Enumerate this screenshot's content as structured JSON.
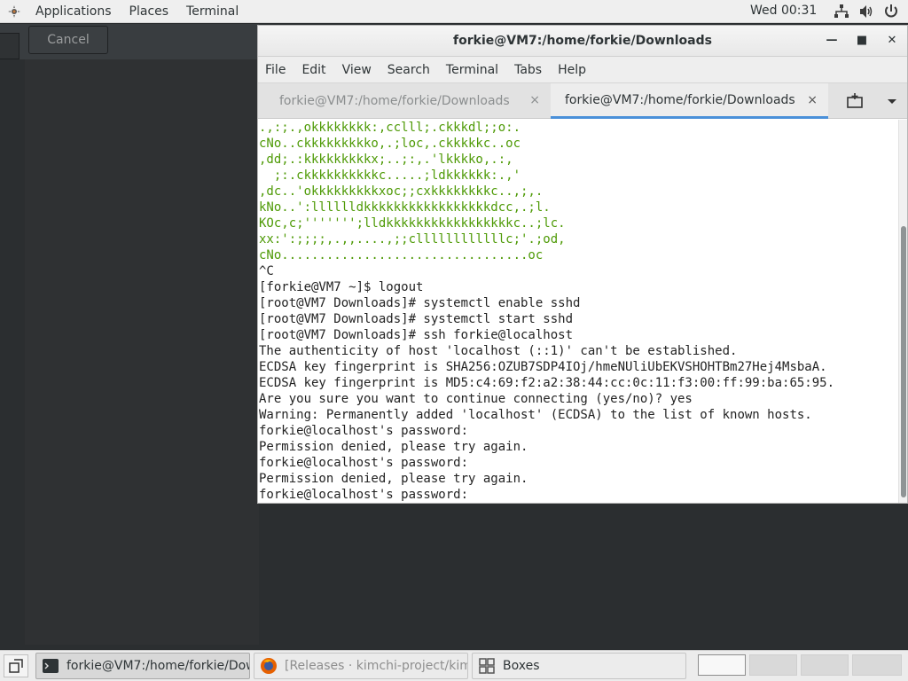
{
  "topbar": {
    "applications": "Applications",
    "places": "Places",
    "terminal": "Terminal",
    "clock": "Wed 00:31",
    "icons": [
      "network-icon",
      "volume-icon",
      "power-icon"
    ]
  },
  "background_dialog": {
    "cancel_label": "Cancel"
  },
  "window": {
    "title": "forkie@VM7:/home/forkie/Downloads",
    "controls": [
      "minimize-icon",
      "maximize-icon",
      "close-icon"
    ],
    "menu": [
      "File",
      "Edit",
      "View",
      "Search",
      "Terminal",
      "Tabs",
      "Help"
    ],
    "tabs": [
      {
        "label": "forkie@VM7:/home/forkie/Downloads",
        "active": false
      },
      {
        "label": "forkie@VM7:/home/forkie/Downloads",
        "active": true
      }
    ],
    "tab_close": "×"
  },
  "terminal": {
    "lines": [
      {
        "text": ".,:;.,okkkkkkkk:,cclll;.ckkkdl;;o:.",
        "color": "green"
      },
      {
        "text": "cNo..ckkkkkkkkko,.;loc,.ckkkkkc..oc",
        "color": "green"
      },
      {
        "text": ",dd;.:kkkkkkkkkx;..;:,.'lkkkko,.:,",
        "color": "green"
      },
      {
        "text": "  ;:.ckkkkkkkkkkc.....;ldkkkkkk:.,'",
        "color": "green"
      },
      {
        "text": ",dc..'okkkkkkkkkxoc;;cxkkkkkkkkc..,;,.",
        "color": "green"
      },
      {
        "text": "kNo..':lllllldkkkkkkkkkkkkkkkkkdcc,.;l.",
        "color": "green"
      },
      {
        "text": "KOc,c;''''''';lldkkkkkkkkkkkkkkkkkc..;lc.",
        "color": "green"
      },
      {
        "text": "xx:':;;;;,.,,....,;;cllllllllllllc;'.;od,",
        "color": "green"
      },
      {
        "text": "cNo.................................oc",
        "color": "green"
      },
      {
        "text": "^C",
        "color": "default"
      },
      {
        "text": "[forkie@VM7 ~]$ logout",
        "color": "default"
      },
      {
        "text": "[root@VM7 Downloads]# systemctl enable sshd",
        "color": "default"
      },
      {
        "text": "[root@VM7 Downloads]# systemctl start sshd",
        "color": "default"
      },
      {
        "text": "[root@VM7 Downloads]# ssh forkie@localhost",
        "color": "default"
      },
      {
        "text": "The authenticity of host 'localhost (::1)' can't be established.",
        "color": "default"
      },
      {
        "text": "ECDSA key fingerprint is SHA256:OZUB7SDP4IOj/hmeNUliUbEKVSHOHTBm27Hej4MsbaA.",
        "color": "default"
      },
      {
        "text": "ECDSA key fingerprint is MD5:c4:69:f2:a2:38:44:cc:0c:11:f3:00:ff:99:ba:65:95.",
        "color": "default"
      },
      {
        "text": "Are you sure you want to continue connecting (yes/no)? yes",
        "color": "default"
      },
      {
        "text": "Warning: Permanently added 'localhost' (ECDSA) to the list of known hosts.",
        "color": "default"
      },
      {
        "text": "forkie@localhost's password:",
        "color": "default"
      },
      {
        "text": "Permission denied, please try again.",
        "color": "default"
      },
      {
        "text": "forkie@localhost's password:",
        "color": "default"
      },
      {
        "text": "Permission denied, please try again.",
        "color": "default"
      },
      {
        "text": "forkie@localhost's password:",
        "color": "default"
      }
    ]
  },
  "taskbar": {
    "tasks": [
      {
        "label": "forkie@VM7:/home/forkie/Dow...",
        "icon": "terminal-icon",
        "state": "active"
      },
      {
        "label": "[Releases · kimchi-project/kimch...",
        "icon": "firefox-icon",
        "state": "dim"
      },
      {
        "label": "Boxes",
        "icon": "boxes-icon",
        "state": "normal"
      }
    ],
    "workspaces": 4,
    "current_workspace": 1
  }
}
